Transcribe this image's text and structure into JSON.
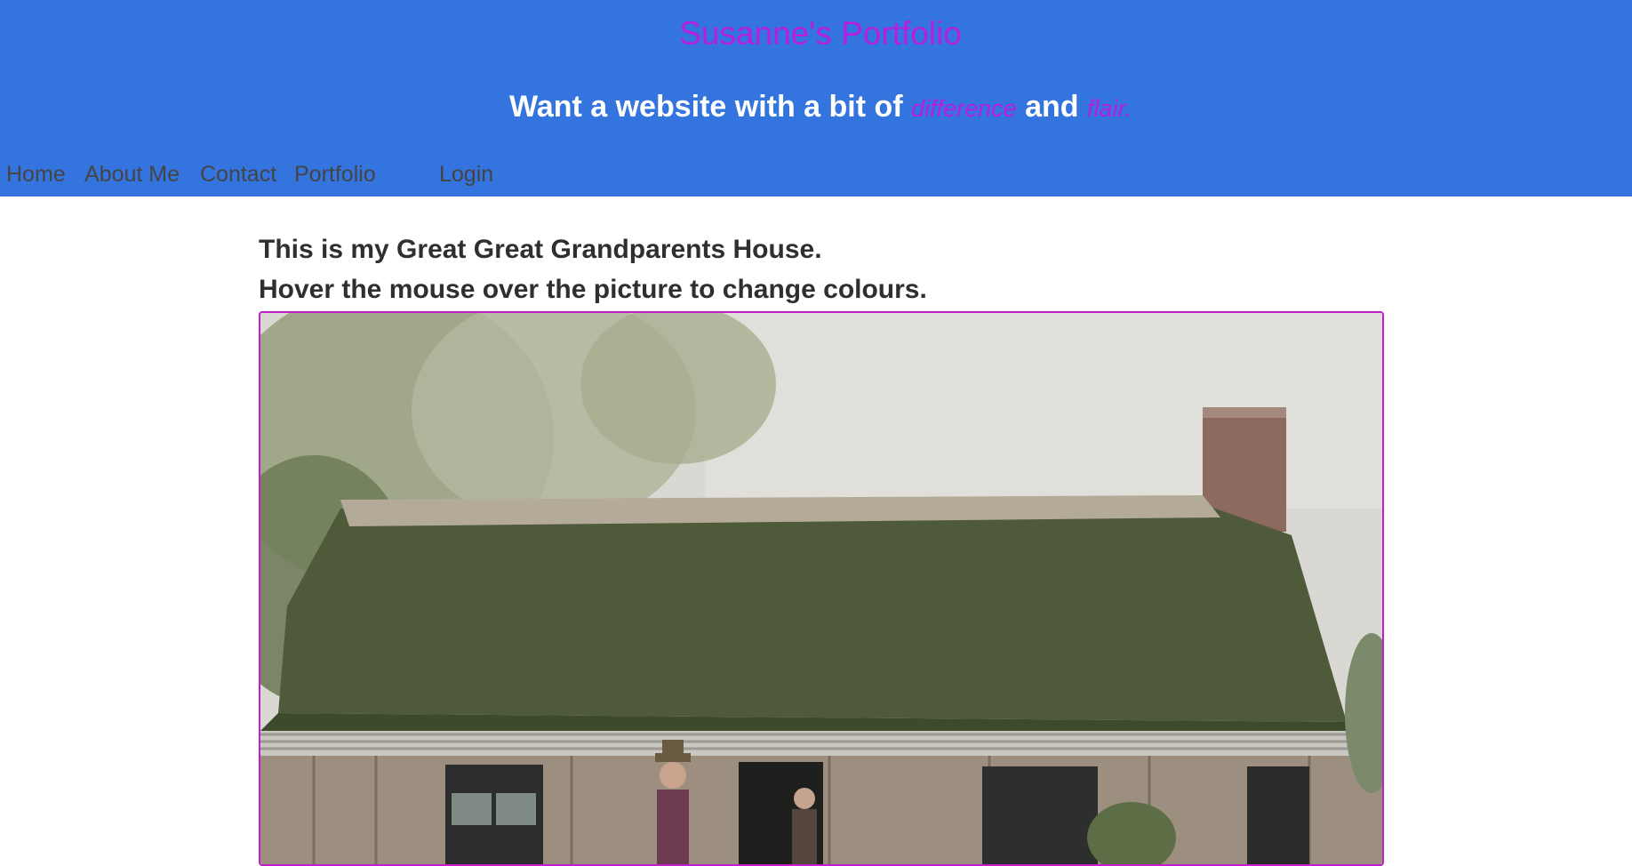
{
  "header": {
    "title": "Susanne's Portfolio",
    "tagline": {
      "before": "Want a website with a bit of",
      "word1": "difference",
      "middle": "and",
      "word2": "flair."
    }
  },
  "nav": {
    "items": [
      "Home",
      "About Me",
      "Contact",
      "Portfolio"
    ],
    "login": "Login"
  },
  "content": {
    "line1": "This is my Great Great Grandparents House.",
    "line2": "Hover the mouse over the picture to change colours."
  },
  "colors": {
    "header_bg": "#3474df",
    "accent": "#b81de0",
    "frame_border": "#c21ec9"
  }
}
